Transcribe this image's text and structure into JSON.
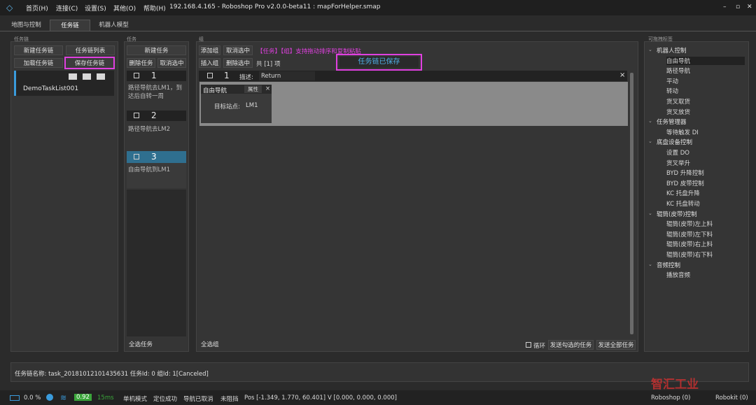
{
  "titlebar": {
    "menus": [
      "首页(H)",
      "连接(C)",
      "设置(S)",
      "其他(O)",
      "帮助(H)"
    ],
    "title": "192.168.4.165 - Roboshop Pro v2.0.0-beta11 : mapForHelper.smap",
    "min": "–",
    "max": "▫",
    "close": "✕"
  },
  "tabs": [
    "地图与控制",
    "任务链",
    "机器人模型"
  ],
  "taskchain": {
    "section": "任务链",
    "new_btn": "新建任务链",
    "list_btn": "任务链列表",
    "load_btn": "加载任务链",
    "save_btn": "保存任务链",
    "item": "DemoTaskList001"
  },
  "tasks": {
    "section": "任务",
    "new_btn": "新建任务",
    "delete_btn": "删除任务",
    "cancel_btn": "取消选中",
    "items": [
      {
        "num": "1",
        "desc": "路径导航去LM1，到达后自转一周"
      },
      {
        "num": "2",
        "desc": "路径导航去LM2"
      },
      {
        "num": "3",
        "desc": "自由导航到LM1"
      }
    ],
    "select_all": "全选任务"
  },
  "groups": {
    "section": "组",
    "add_btn": "添加组",
    "cancel_btn": "取消选中",
    "hint": "【任务】【组】支持拖动排序和复制粘贴",
    "insert_btn": "插入组",
    "delete_btn": "删除选中",
    "count": "共 [1] 项",
    "saved_notice": "任务链已保存",
    "group_num": "1",
    "desc_label": "描述:",
    "desc_value": "Return",
    "close": "×",
    "card_title": "自由导航",
    "card_props": "属性",
    "card_close": "×",
    "target_label": "目标站点:",
    "target_value": "LM1",
    "select_all": "全选组",
    "loop_label": "循环",
    "send_checked": "发送勾选的任务",
    "send_all": "发送全部任务"
  },
  "tags": {
    "section": "可拖拽标签",
    "groups": [
      {
        "name": "机器人控制",
        "items": [
          "自由导航",
          "路径导航",
          "平动",
          "转动",
          "货叉取货",
          "货叉放货"
        ]
      },
      {
        "name": "任务管理器",
        "items": [
          "等待触发 DI"
        ]
      },
      {
        "name": "底盘设备控制",
        "items": [
          "设置 DO",
          "货叉举升",
          "BYD 升降控制",
          "BYD 皮带控制",
          "KC 托盘升降",
          "KC 托盘转动"
        ]
      },
      {
        "name": "辊筒(皮带)控制",
        "items": [
          "辊筒(皮带)左上料",
          "辊筒(皮带)左下料",
          "辊筒(皮带)右上料",
          "辊筒(皮带)右下料"
        ]
      },
      {
        "name": "音频控制",
        "items": [
          "播放音频"
        ]
      }
    ]
  },
  "info": {
    "text": "任务链名称:   task_20181012101435631 任务Id: 0 组Id: 1[Canceled]"
  },
  "statusbar": {
    "battery": "0.0 %",
    "signal": "0.92",
    "latency": "15ms",
    "mode": "单机模式",
    "locate": "定位成功",
    "nav": "导航已取消",
    "block": "未阻挡",
    "pos": "Pos [-1.349, 1.770, 60.401]",
    "vel": "V [0.000, 0.000, 0.000]",
    "roboshop": "Roboshop (0)",
    "robokit": "Robokit (0)"
  },
  "watermark": "智汇工业",
  "colors": {
    "accent": "#e040e0",
    "selected": "#2f6f8f",
    "battery": "#3a9bdc",
    "signal": "#3aa53a"
  }
}
